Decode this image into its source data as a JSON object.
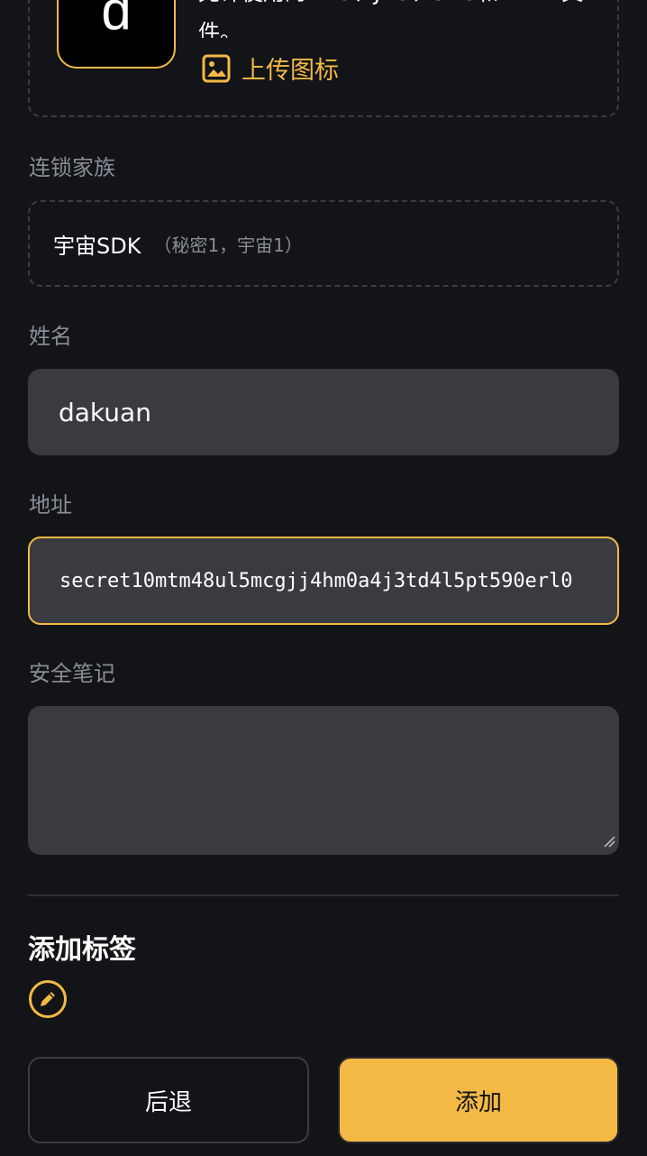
{
  "icon_section": {
    "avatar_letter": "d",
    "hint_text": "允许使用的PNG、JPG、SVG和WEBP文件。",
    "upload_label": "上传图标"
  },
  "chain_family": {
    "label": "连锁家族",
    "value": "宇宙SDK",
    "sub": "（秘密1，宇宙1）"
  },
  "name_field": {
    "label": "姓名",
    "value": "dakuan"
  },
  "address_field": {
    "label": "地址",
    "value": "secret10mtm48ul5mcgjj4hm0a4j3td4l5pt590erl0"
  },
  "notes_field": {
    "label": "安全笔记",
    "value": ""
  },
  "tags": {
    "title": "添加标签"
  },
  "actions": {
    "back_label": "后退",
    "add_label": "添加"
  },
  "colors": {
    "background": "#121418",
    "accent": "#f3b944",
    "field_bg": "#3a3b40",
    "muted_text": "#8a8d94"
  }
}
